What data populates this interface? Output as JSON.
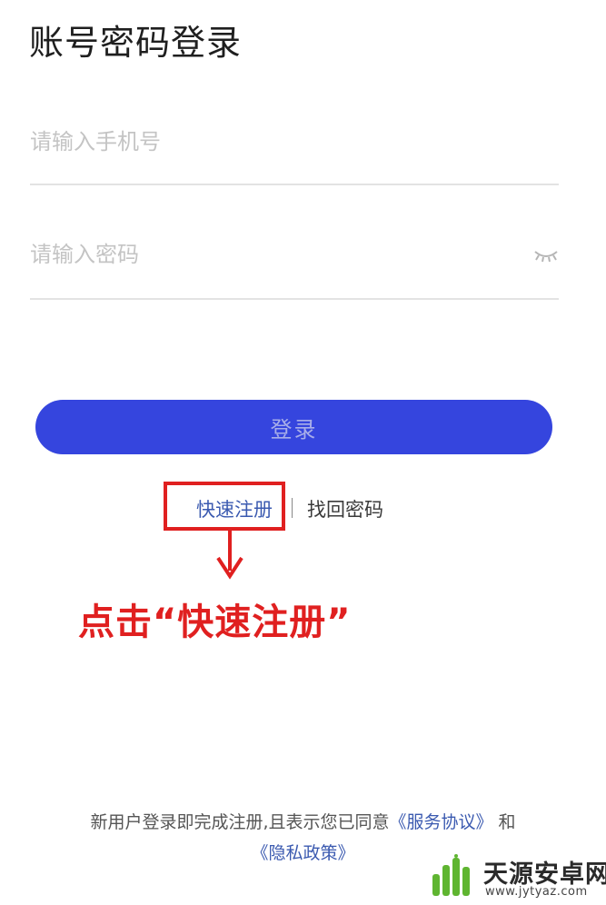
{
  "page": {
    "title": "账号密码登录"
  },
  "form": {
    "phone_placeholder": "请输入手机号",
    "phone_value": "",
    "password_placeholder": "请输入密码",
    "password_value": "",
    "password_toggle_icon": "eye-closed-icon"
  },
  "login_button": {
    "label": "登录",
    "color": "#3545de"
  },
  "links": {
    "register": "快速注册",
    "divider": "|",
    "forgot_password": "找回密码"
  },
  "annotation": {
    "text": "点击“快速注册”",
    "color": "#e02020",
    "arrow_icon": "arrow-down-icon"
  },
  "footer": {
    "prefix": "新用户登录即完成注册,且表示您已同意",
    "service_agreement": "《服务协议》",
    "conjunction": "和",
    "privacy_policy": "《隐私政策》",
    "link_color": "#3b5ab0"
  },
  "watermark": {
    "name": "天源安卓网",
    "url": "www.jytyaz.com",
    "logo_icon": "android-logo-icon"
  }
}
